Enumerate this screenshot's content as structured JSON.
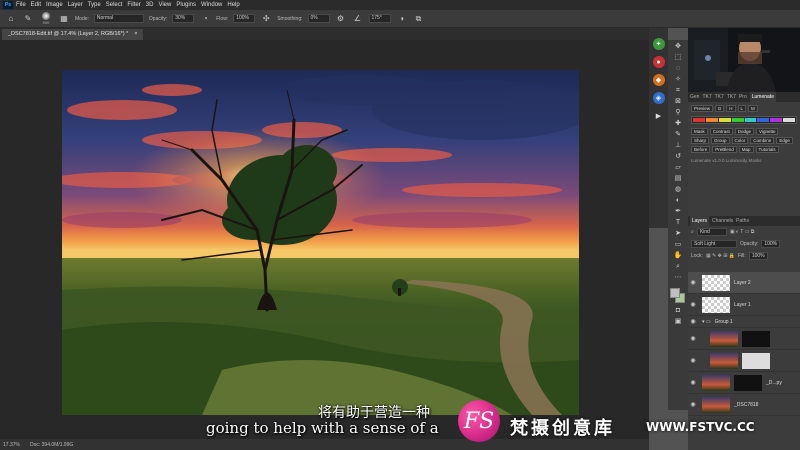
{
  "app": {
    "logo": "Ps"
  },
  "menu": [
    "File",
    "Edit",
    "Image",
    "Layer",
    "Type",
    "Select",
    "Filter",
    "3D",
    "View",
    "Plugins",
    "Window",
    "Help"
  ],
  "options": {
    "brush_size": "500",
    "mode_label": "Mode:",
    "mode_value": "Normal",
    "opacity_label": "Opacity:",
    "opacity_value": "30%",
    "flow_label": "Flow:",
    "flow_value": "100%",
    "smoothing_label": "Smoothing:",
    "smoothing_value": "0%",
    "angle_value": "175°"
  },
  "document": {
    "tab_title": "_DSC7818-Edit.tif @ 17.4% (Layer 2, RGB/16*) *",
    "close": "×"
  },
  "status": {
    "zoom": "17.37%",
    "doc": "Doc: 394.0M/1.99G"
  },
  "panel": {
    "tabs": [
      "Gen",
      "TK7",
      "TK7",
      "TK7",
      "Pro",
      "Lumenate"
    ],
    "lumenate_buttons": [
      "Preview",
      "D",
      "H",
      "L",
      "M",
      "Mask",
      "Contrast",
      "Dodge",
      "Vignette",
      "Sharp",
      "Group",
      "Color",
      "Combine",
      "Edge",
      "Before",
      "PreBlend",
      "Map",
      "Tutorials"
    ],
    "lumenate_footer": "Lumenate v1.0.0 Luminosity Masks",
    "layers_tabs": [
      "Layers",
      "Channels",
      "Paths"
    ],
    "kind_label": "Kind",
    "blend_mode": "Soft Light",
    "opacity_label": "Opacity:",
    "opacity_value": "100%",
    "lock_label": "Lock:",
    "fill_label": "Fill:",
    "fill_value": "100%"
  },
  "layers": [
    {
      "name": "Layer 2",
      "selected": true
    },
    {
      "name": "Layer 1",
      "selected": false
    },
    {
      "name": "Group 1",
      "selected": false
    },
    {
      "name": "",
      "selected": false
    },
    {
      "name": "",
      "selected": false
    },
    {
      "name": "_D...py",
      "selected": false
    },
    {
      "name": "_DSC7818",
      "selected": false
    }
  ],
  "subtitles": {
    "cn": "将有助于营造一种",
    "en": "going to help with a sense of a"
  },
  "watermark": {
    "logo": "FS",
    "cn": "梵摄创意库",
    "url": "WWW.FSTVC.CC"
  },
  "colors": {
    "accent_pink": "#d62a8a",
    "ui_dark": "#282828"
  }
}
